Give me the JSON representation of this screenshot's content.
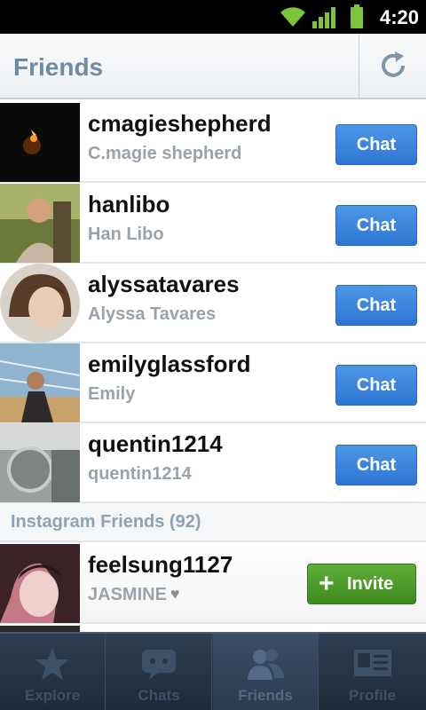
{
  "status": {
    "time": "4:20"
  },
  "header": {
    "title": "Friends"
  },
  "friends": [
    {
      "username": "cmagieshepherd",
      "full_name": "C.magie shepherd",
      "action": "Chat"
    },
    {
      "username": "hanlibo",
      "full_name": "Han Libo",
      "action": "Chat"
    },
    {
      "username": "alyssatavares",
      "full_name": "Alyssa Tavares",
      "action": "Chat"
    },
    {
      "username": "emilyglassford",
      "full_name": "Emily",
      "action": "Chat"
    },
    {
      "username": "quentin1214",
      "full_name": "quentin1214",
      "action": "Chat"
    }
  ],
  "section": {
    "label": "Instagram Friends (92)"
  },
  "invite": {
    "username": "feelsung1127",
    "full_name": "JASMINE",
    "action": "Invite"
  },
  "tabs": [
    {
      "label": "Explore",
      "icon": "star-icon"
    },
    {
      "label": "Chats",
      "icon": "chat-bubble-icon"
    },
    {
      "label": "Friends",
      "icon": "friends-icon"
    },
    {
      "label": "Profile",
      "icon": "profile-card-icon"
    }
  ],
  "colors": {
    "chat_button": "#3b84dc",
    "invite_button": "#4c9a2a",
    "title": "#6d8aa6",
    "tabbar": "#243446"
  }
}
